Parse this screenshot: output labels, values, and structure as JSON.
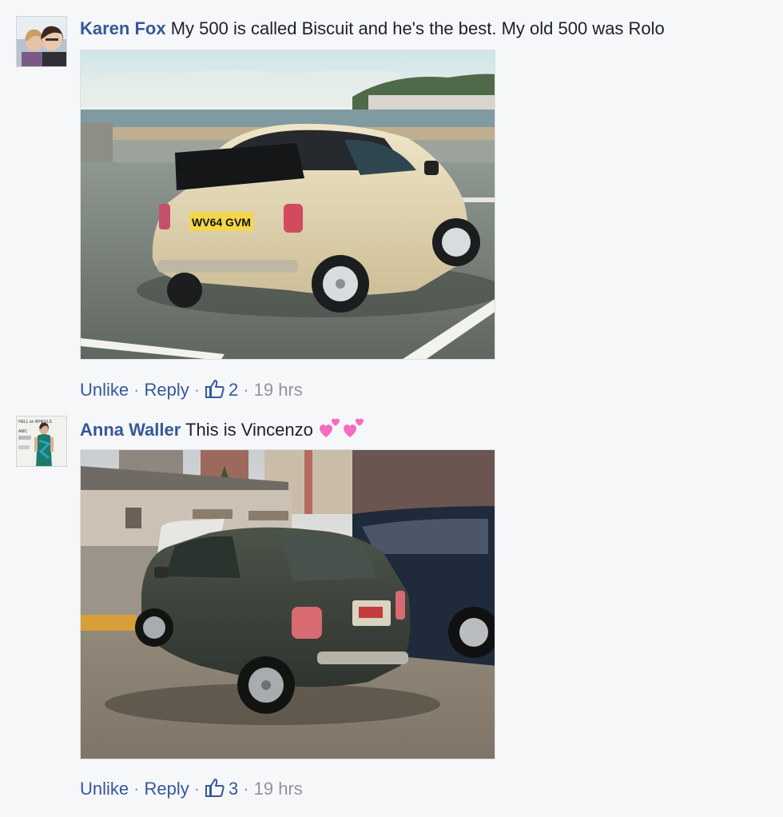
{
  "comments": [
    {
      "author": "Karen Fox",
      "text": "My 500 is called Biscuit and he's the best. My old 500 was Rolo",
      "photo_plate": "WV64 GVM",
      "actions": {
        "unlike": "Unlike",
        "reply": "Reply",
        "likes": "2",
        "time": "19 hrs"
      }
    },
    {
      "author": "Anna Waller",
      "text": "This is Vincenzo",
      "emoji": [
        "two-hearts-icon",
        "two-hearts-icon"
      ],
      "avatar_sign_text": [
        "HELL on WHEELS",
        "AMC"
      ],
      "actions": {
        "unlike": "Unlike",
        "reply": "Reply",
        "likes": "3",
        "time": "19 hrs"
      }
    }
  ],
  "colors": {
    "link": "#365899",
    "meta": "#90949c",
    "background": "#f6f7f9"
  }
}
